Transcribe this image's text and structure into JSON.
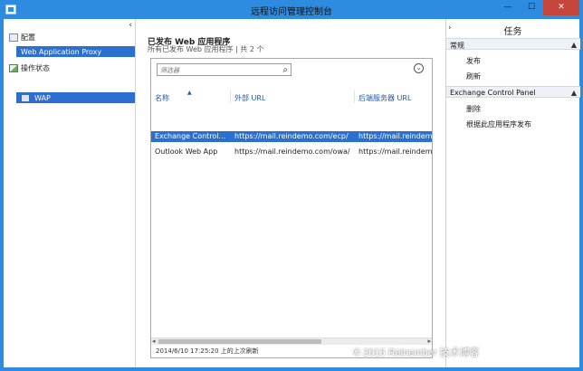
{
  "window": {
    "title": "远程访问管理控制台",
    "buttons": {
      "minimize": "—",
      "maximize": "☐",
      "close": "✕"
    }
  },
  "left_nav": {
    "collapse": "‹",
    "config_label": "配置",
    "selected_item": "Web Application Proxy",
    "status_label": "操作状态",
    "server_item": "WAP"
  },
  "center": {
    "title": "已发布 Web 应用程序",
    "subtitle": "所有已发布 Web 应用程序 | 共 2 个",
    "search": {
      "placeholder": "筛选器"
    },
    "columns": [
      "名称",
      "外部 URL",
      "后端服务器 URL"
    ],
    "rows": [
      {
        "name": "Exchange Control...",
        "external": "https://mail.reindemo.com/ecp/",
        "backend": "https://mail.reindemo.com/ecp/"
      },
      {
        "name": "Outlook Web App",
        "external": "https://mail.reindemo.com/owa/",
        "backend": "https://mail.reindemo.com/owa/"
      }
    ],
    "status": "2014/6/10 17:25:20 上的上次刷新"
  },
  "right_pane": {
    "title": "任务",
    "collapse": "›",
    "groups": [
      {
        "label": "常规",
        "actions": [
          "发布",
          "刷新"
        ]
      },
      {
        "label": "Exchange Control Panel",
        "actions": [
          "删除",
          "根据此应用程序发布"
        ]
      }
    ]
  },
  "watermark": "© 2015 Reinember 技术博客",
  "colors": {
    "titlebar": "#2d8be0",
    "selection": "#2b6fd0",
    "close": "#c7463c"
  }
}
